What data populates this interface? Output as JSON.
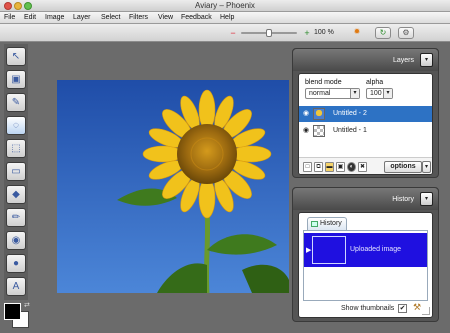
{
  "window": {
    "title": "Aviary – Phoenix"
  },
  "menu": {
    "items": [
      "File",
      "Edit",
      "Image",
      "Layer",
      "Select",
      "Filters",
      "View",
      "Feedback",
      "Help"
    ]
  },
  "toolbar": {
    "zoom_label": "100 %",
    "zoom_level": 1.0
  },
  "tools": {
    "items": [
      "move-tool",
      "transform-tool",
      "brush-tool",
      "lasso-tool",
      "marquee-tool",
      "eraser-tool",
      "fill-tool",
      "pencil-tool",
      "stamp-tool",
      "blur-tool",
      "text-tool"
    ]
  },
  "colors": {
    "foreground": "#000000",
    "background": "#ffffff",
    "accent": "#2d72c4",
    "history_selected": "#1f10e0"
  },
  "layers_panel": {
    "title": "Layers",
    "blend_mode_label": "blend mode",
    "blend_mode_value": "normal",
    "alpha_label": "alpha",
    "alpha_value": "100",
    "layers": [
      {
        "name": "Untitled - 2",
        "selected": true
      },
      {
        "name": "Untitled - 1",
        "selected": false
      }
    ],
    "options_label": "options"
  },
  "history_panel": {
    "title": "History",
    "tab_label": "History",
    "items": [
      {
        "label": "Uploaded image",
        "selected": true
      }
    ],
    "show_thumbnails_label": "Show thumbnails",
    "show_thumbnails_checked": true
  }
}
